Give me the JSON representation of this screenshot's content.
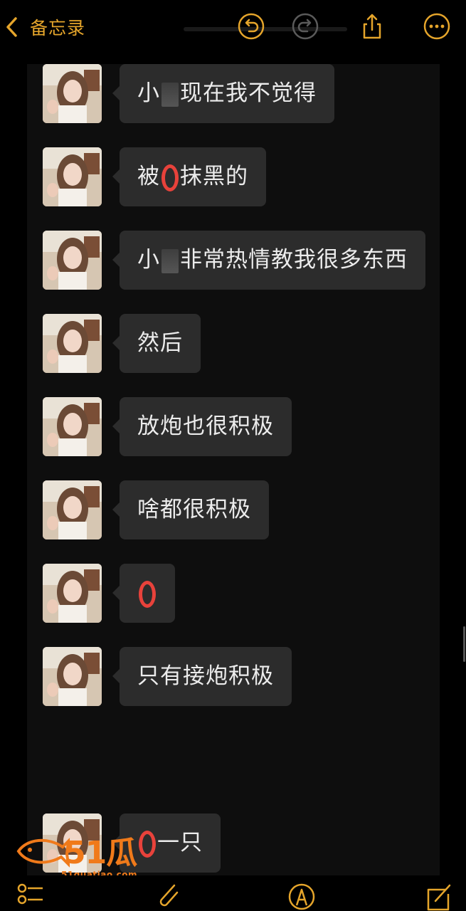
{
  "header": {
    "back_label": "备忘录",
    "icons": [
      "back-chevron-icon",
      "undo-icon",
      "redo-icon",
      "share-icon",
      "more-icon"
    ]
  },
  "theme": {
    "accent": "#e5a52b",
    "bubble": "#2c2c2c",
    "redmark": "#e8423b"
  },
  "messages": [
    {
      "before": "小",
      "mark": "redact",
      "after": "现在我不觉得"
    },
    {
      "before": "被",
      "mark": "red-o",
      "after": "抹黑的"
    },
    {
      "before": "小",
      "mark": "redact",
      "after": "非常热情教我很多东西"
    },
    {
      "before": "然后",
      "mark": "",
      "after": ""
    },
    {
      "before": "放炮也很积极",
      "mark": "",
      "after": ""
    },
    {
      "before": "啥都很积极",
      "mark": "",
      "after": ""
    },
    {
      "before": "",
      "mark": "red-o",
      "after": ""
    },
    {
      "before": "只有接炮积极",
      "mark": "",
      "after": ""
    },
    {
      "before": "",
      "mark": "red-o",
      "after": "一只"
    }
  ],
  "watermark": {
    "brand": "51瓜条",
    "url": "51guatiao.com"
  },
  "footer": {
    "icons": [
      "checklist-icon",
      "attachment-icon",
      "markup-icon",
      "compose-icon"
    ]
  }
}
